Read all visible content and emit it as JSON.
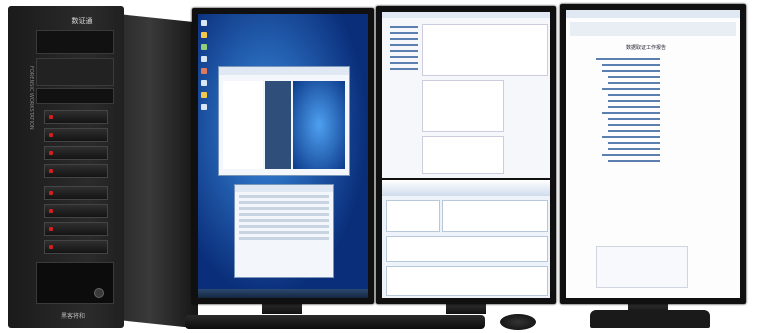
{
  "tower": {
    "brand_logo": "数证通",
    "front_label": "FORENSIC WORKSTATION",
    "bottom_label": "黑客将和"
  },
  "monitor_2": {
    "title": "数据取证工作报告"
  }
}
